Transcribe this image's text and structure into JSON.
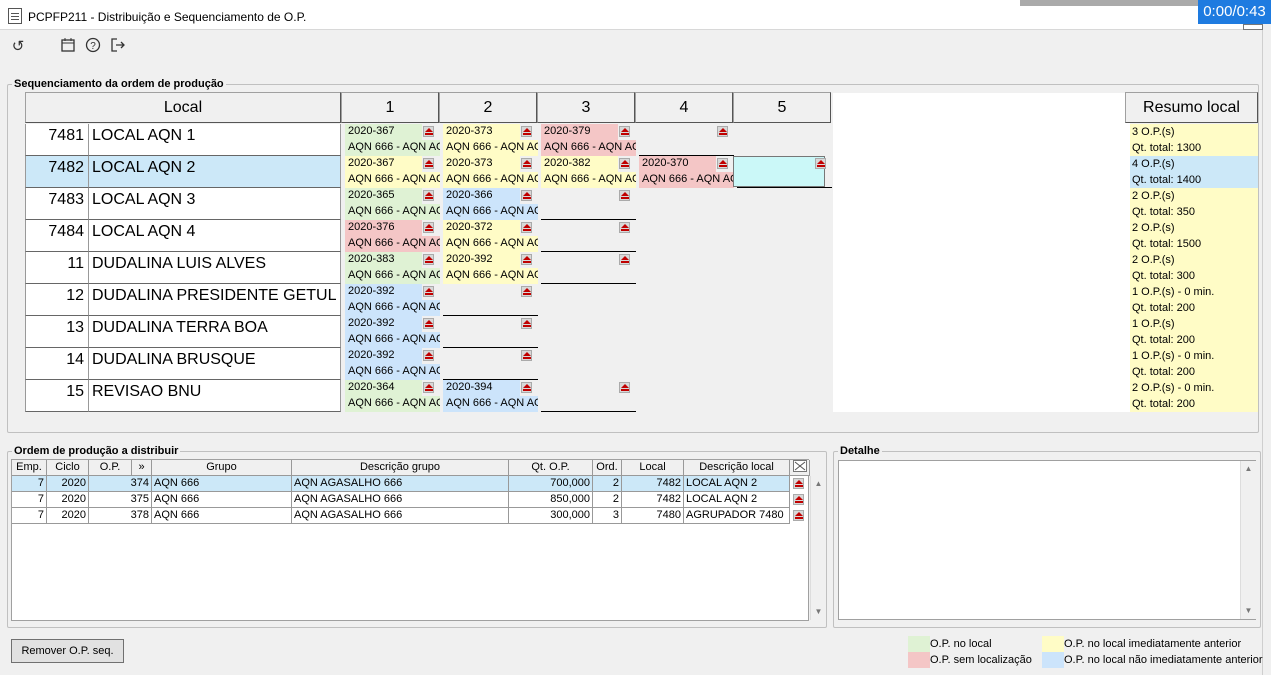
{
  "window": {
    "title": "PCPFP211 - Distribuição e Sequenciamento de O.P.",
    "timer": "0:00/0:43"
  },
  "toolbar": {
    "icons": [
      "refresh-icon",
      "calendar-icon",
      "help-icon",
      "exit-icon"
    ]
  },
  "sequencing": {
    "legend": "Sequenciamento da ordem de produção",
    "headers": {
      "local": "Local",
      "c1": "1",
      "c2": "2",
      "c3": "3",
      "c4": "4",
      "c5": "5",
      "summary": "Resumo local"
    },
    "rows": [
      {
        "code": "7481",
        "name": "LOCAL AQN 1",
        "summary": [
          "3 O.P.(s)",
          "Qt. total: 1300"
        ],
        "ops": [
          {
            "op": "2020-367",
            "desc": "AQN 666 - AQN AG",
            "color": "g"
          },
          {
            "op": "2020-373",
            "desc": "AQN 666 - AQN AG",
            "color": "y"
          },
          {
            "op": "2020-379",
            "desc": "AQN 666 - AQN AG",
            "color": "r"
          },
          {
            "op": "",
            "desc": "",
            "color": ""
          }
        ]
      },
      {
        "code": "7482",
        "name": "LOCAL AQN 2",
        "selected": true,
        "summary": [
          "4 O.P.(s)",
          "Qt. total: 1400"
        ],
        "ops": [
          {
            "op": "2020-367",
            "desc": "AQN 666 - AQN AG",
            "color": "y"
          },
          {
            "op": "2020-373",
            "desc": "AQN 666 - AQN AG",
            "color": "y"
          },
          {
            "op": "2020-382",
            "desc": "AQN 666 - AQN AG",
            "color": "y"
          },
          {
            "op": "2020-370",
            "desc": "AQN 666 - AQN AG",
            "color": "r"
          },
          {
            "op": "",
            "desc": "",
            "color": "c"
          }
        ]
      },
      {
        "code": "7483",
        "name": "LOCAL AQN 3",
        "summary": [
          "2 O.P.(s)",
          "Qt. total: 350"
        ],
        "ops": [
          {
            "op": "2020-365",
            "desc": "AQN 666 - AQN AG",
            "color": "g"
          },
          {
            "op": "2020-366",
            "desc": "AQN 666 - AQN AG",
            "color": "b"
          },
          {
            "op": "",
            "desc": "",
            "color": ""
          }
        ]
      },
      {
        "code": "7484",
        "name": "LOCAL AQN 4",
        "summary": [
          "2 O.P.(s)",
          "Qt. total: 1500"
        ],
        "ops": [
          {
            "op": "2020-376",
            "desc": "AQN 666 - AQN AG",
            "color": "r"
          },
          {
            "op": "2020-372",
            "desc": "AQN 666 - AQN AG",
            "color": "y"
          },
          {
            "op": "",
            "desc": "",
            "color": ""
          }
        ]
      },
      {
        "code": "11",
        "name": "DUDALINA LUIS ALVES",
        "summary": [
          "2 O.P.(s)",
          "Qt. total: 300"
        ],
        "ops": [
          {
            "op": "2020-383",
            "desc": "AQN 666 - AQN AG",
            "color": "g"
          },
          {
            "op": "2020-392",
            "desc": "AQN 666 - AQN AG",
            "color": "y"
          },
          {
            "op": "",
            "desc": "",
            "color": ""
          }
        ]
      },
      {
        "code": "12",
        "name": "DUDALINA PRESIDENTE GETUL",
        "summary": [
          "1 O.P.(s) - 0 min.",
          "Qt. total: 200"
        ],
        "ops": [
          {
            "op": "2020-392",
            "desc": "AQN 666 - AQN AG",
            "color": "b"
          },
          {
            "op": "",
            "desc": "",
            "color": ""
          }
        ]
      },
      {
        "code": "13",
        "name": "DUDALINA TERRA BOA",
        "summary": [
          "1 O.P.(s)",
          "Qt. total: 200"
        ],
        "ops": [
          {
            "op": "2020-392",
            "desc": "AQN 666 - AQN AG",
            "color": "b"
          },
          {
            "op": "",
            "desc": "",
            "color": ""
          }
        ]
      },
      {
        "code": "14",
        "name": "DUDALINA BRUSQUE",
        "summary": [
          "1 O.P.(s) - 0 min.",
          "Qt. total: 200"
        ],
        "ops": [
          {
            "op": "2020-392",
            "desc": "AQN 666 - AQN AG",
            "color": "b"
          },
          {
            "op": "",
            "desc": "",
            "color": ""
          }
        ]
      },
      {
        "code": "15",
        "name": "REVISAO BNU",
        "summary": [
          "2 O.P.(s) - 0 min.",
          "Qt. total: 200"
        ],
        "ops": [
          {
            "op": "2020-364",
            "desc": "AQN 666 - AQN AG",
            "color": "g"
          },
          {
            "op": "2020-394",
            "desc": "AQN 666 - AQN AG",
            "color": "b"
          },
          {
            "op": "",
            "desc": "",
            "color": ""
          }
        ]
      }
    ]
  },
  "distribution": {
    "legend": "Ordem de produção a distribuir",
    "columns": [
      "Emp.",
      "Ciclo",
      "O.P.",
      "»",
      "Grupo",
      "Descrição grupo",
      "Qt. O.P.",
      "Ord.",
      "Local",
      "Descrição local"
    ],
    "rows": [
      [
        "7",
        "2020",
        "374",
        "AQN 666",
        "AQN AGASALHO 666",
        "700,000",
        "2",
        "7482",
        "LOCAL AQN 2"
      ],
      [
        "7",
        "2020",
        "375",
        "AQN 666",
        "AQN AGASALHO 666",
        "850,000",
        "2",
        "7482",
        "LOCAL AQN 2"
      ],
      [
        "7",
        "2020",
        "378",
        "AQN 666",
        "AQN AGASALHO 666",
        "300,000",
        "3",
        "7480",
        "AGRUPADOR 7480"
      ]
    ]
  },
  "detail": {
    "legend": "Detalhe"
  },
  "buttons": {
    "remove": "Remover O.P. seq."
  },
  "color_legend": [
    {
      "label": "O.P. no local",
      "color": "#dff2d4"
    },
    {
      "label": "O.P. no local imediatamente anterior",
      "color": "#fffcc6"
    },
    {
      "label": "O.P. sem localização",
      "color": "#f4c6c6"
    },
    {
      "label": "O.P. no local não imediatamente anterior",
      "color": "#cce4fb"
    }
  ]
}
